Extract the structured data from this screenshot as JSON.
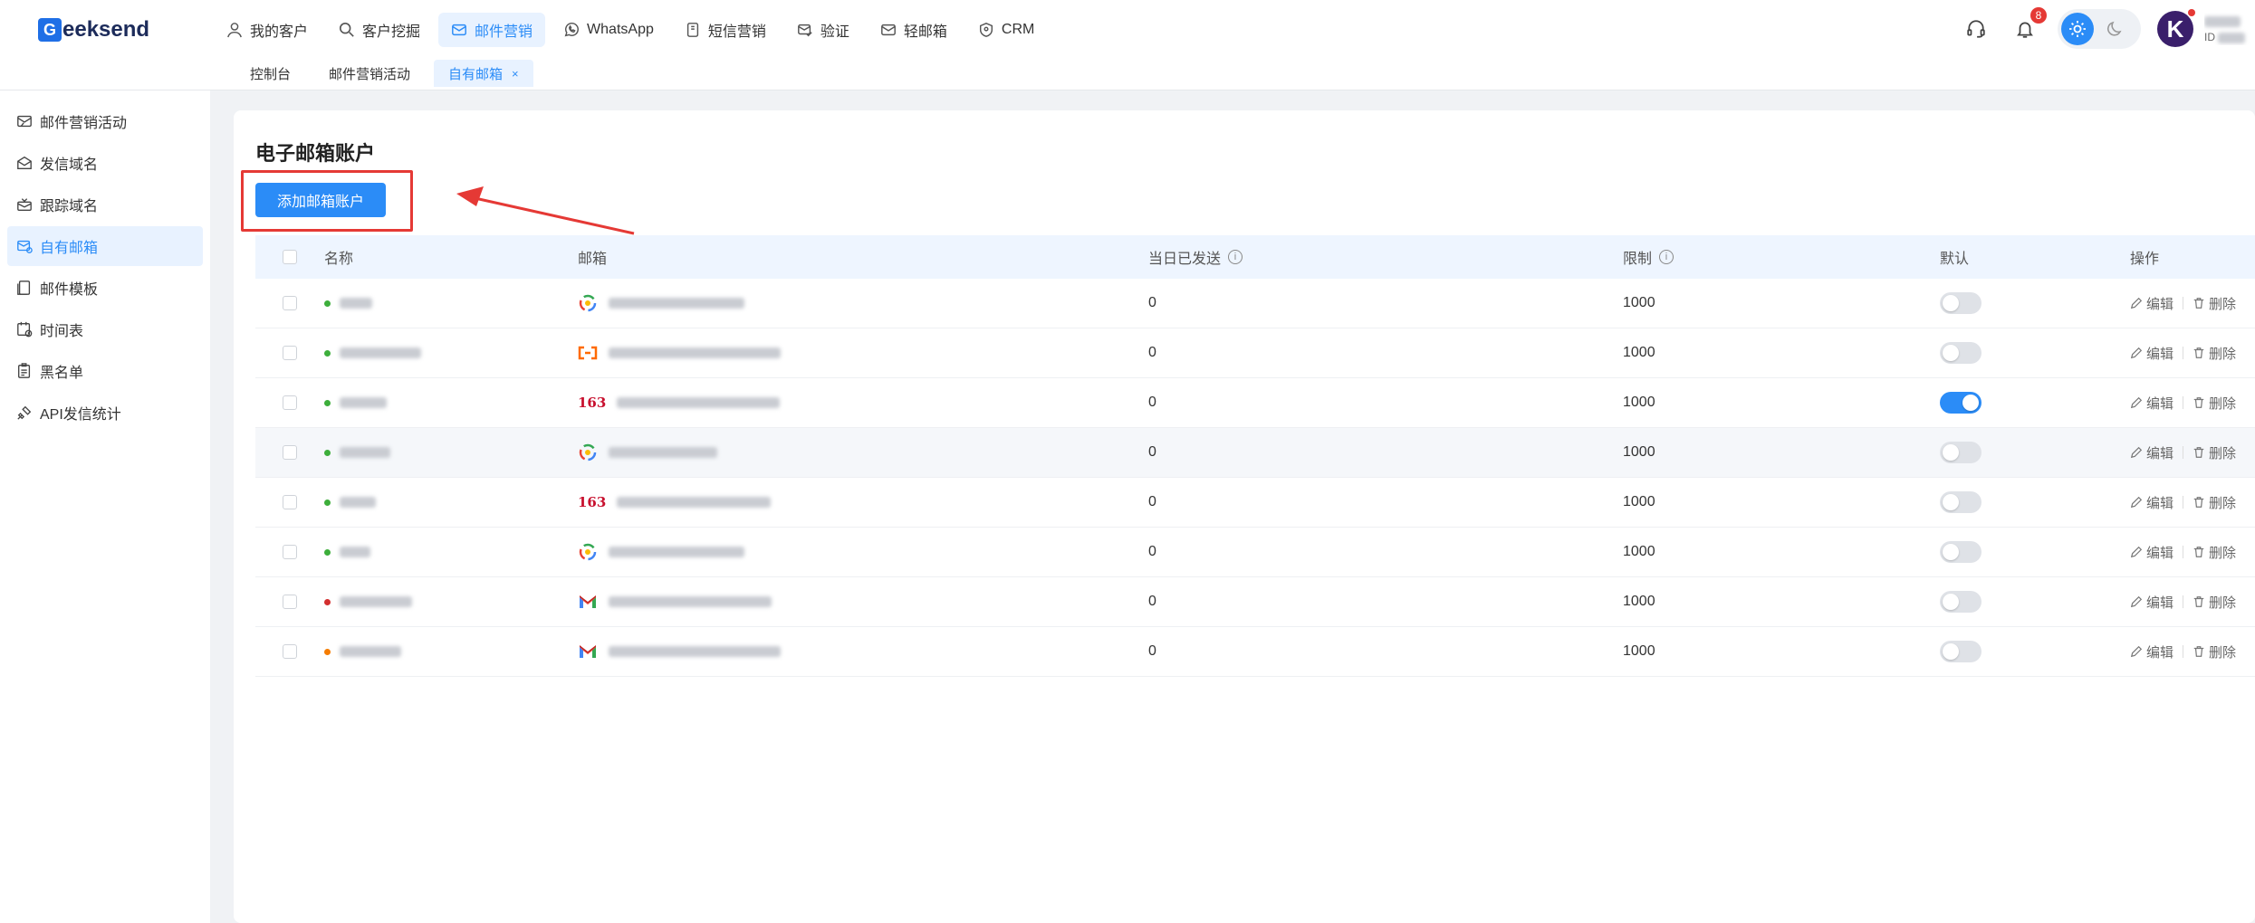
{
  "brand": {
    "logo_mark": "G",
    "logo_text": "eeksend"
  },
  "nav": [
    {
      "label": "我的客户",
      "icon": "user-icon",
      "active": false
    },
    {
      "label": "客户挖掘",
      "icon": "search-icon",
      "active": false
    },
    {
      "label": "邮件营销",
      "icon": "mail-icon",
      "active": true
    },
    {
      "label": "WhatsApp",
      "icon": "whatsapp-icon",
      "active": false
    },
    {
      "label": "短信营销",
      "icon": "sms-icon",
      "active": false
    },
    {
      "label": "验证",
      "icon": "verify-mail-icon",
      "active": false
    },
    {
      "label": "轻邮箱",
      "icon": "light-mail-icon",
      "active": false
    },
    {
      "label": "CRM",
      "icon": "crm-icon",
      "active": false
    }
  ],
  "tabs": [
    {
      "label": "控制台"
    },
    {
      "label": "邮件营销活动"
    },
    {
      "label": "自有邮箱",
      "active": true,
      "close": "×"
    }
  ],
  "header": {
    "notification_count": "8",
    "user_id_prefix": "ID"
  },
  "sidebar": [
    {
      "label": "邮件营销活动",
      "icon": "campaign-icon"
    },
    {
      "label": "发信域名",
      "icon": "sender-domain-icon"
    },
    {
      "label": "跟踪域名",
      "icon": "tracking-domain-icon"
    },
    {
      "label": "自有邮箱",
      "icon": "own-mailbox-icon",
      "active": true
    },
    {
      "label": "邮件模板",
      "icon": "template-icon"
    },
    {
      "label": "时间表",
      "icon": "schedule-icon"
    },
    {
      "label": "黑名单",
      "icon": "blacklist-icon"
    },
    {
      "label": "API发信统计",
      "icon": "api-stats-icon"
    }
  ],
  "page": {
    "title": "电子邮箱账户",
    "add_button": "添加邮箱账户"
  },
  "table": {
    "columns": {
      "name": "名称",
      "mailbox": "邮箱",
      "sent_today": "当日已发送",
      "limit": "限制",
      "default": "默认",
      "actions": "操作"
    },
    "edit_label": "编辑",
    "delete_label": "删除",
    "rows": [
      {
        "status": "green",
        "provider": "google-workspace-icon",
        "sent": "0",
        "limit": "1000",
        "default": false
      },
      {
        "status": "green",
        "provider": "aliyun-icon",
        "sent": "0",
        "limit": "1000",
        "default": false
      },
      {
        "status": "green",
        "provider": "163",
        "sent": "0",
        "limit": "1000",
        "default": true
      },
      {
        "status": "green",
        "provider": "google-workspace-icon",
        "sent": "0",
        "limit": "1000",
        "default": false
      },
      {
        "status": "green",
        "provider": "163",
        "sent": "0",
        "limit": "1000",
        "default": false
      },
      {
        "status": "green",
        "provider": "google-workspace-icon",
        "sent": "0",
        "limit": "1000",
        "default": false
      },
      {
        "status": "red",
        "provider": "gmail-icon",
        "sent": "0",
        "limit": "1000",
        "default": false
      },
      {
        "status": "orange",
        "provider": "gmail-icon",
        "sent": "0",
        "limit": "1000",
        "default": false
      }
    ]
  },
  "colors": {
    "accent": "#2b8cf7",
    "status_green": "#3dae3b",
    "status_red": "#d32f2f",
    "status_orange": "#f57c00",
    "annotation_red": "#e53935"
  }
}
